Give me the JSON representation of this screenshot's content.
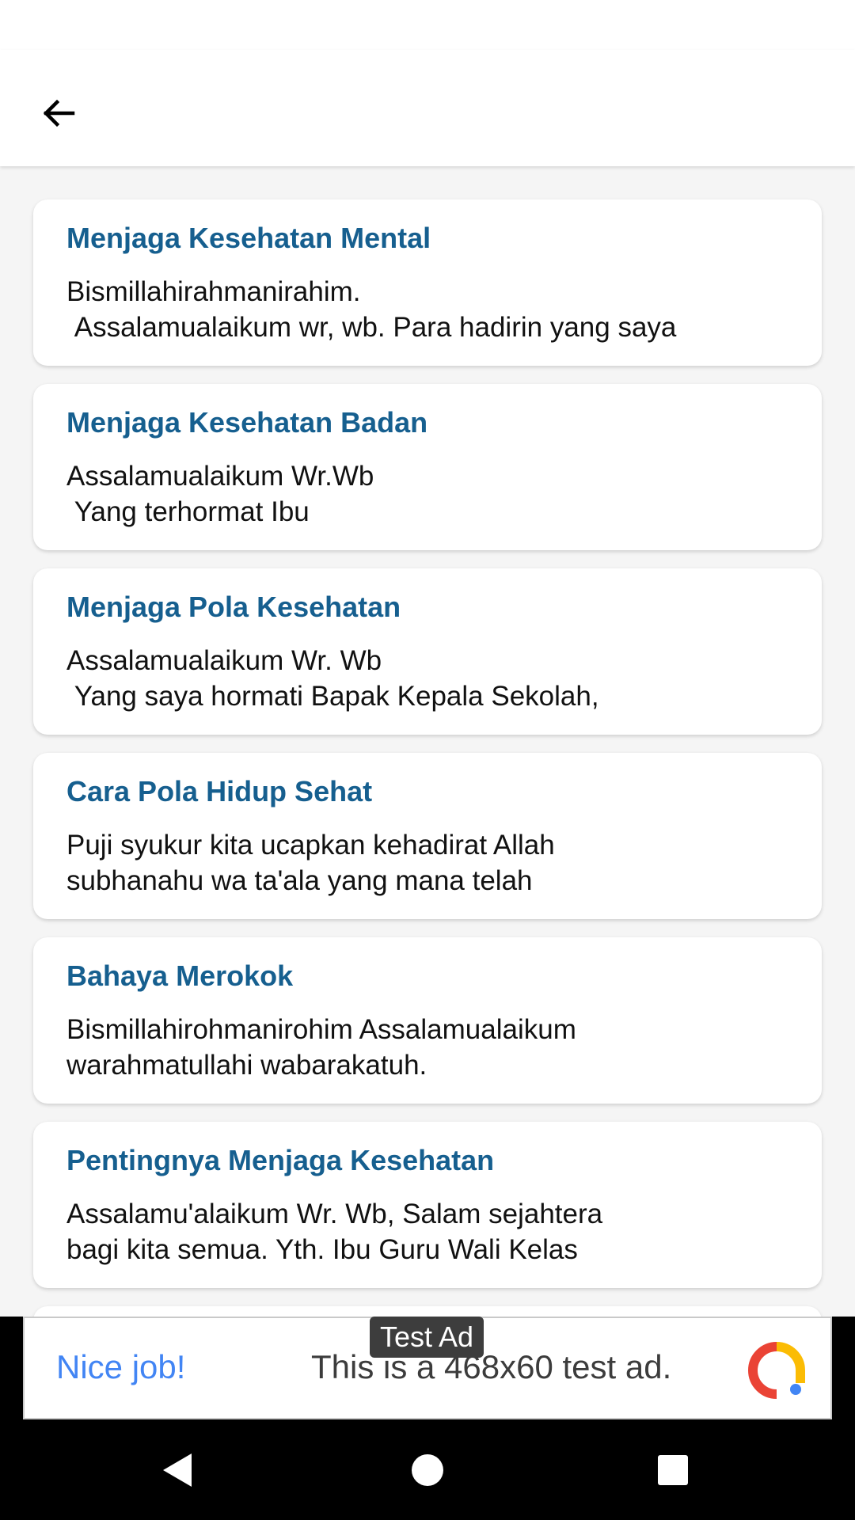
{
  "appbar": {
    "back_icon": "arrow-left-icon"
  },
  "cards": [
    {
      "title": "Menjaga Kesehatan Mental",
      "body": "Bismillahirahmanirahim.\n Assalamualaikum wr, wb. Para hadirin yang saya"
    },
    {
      "title": "Menjaga Kesehatan Badan",
      "body": "Assalamualaikum Wr.Wb\n Yang terhormat Ibu"
    },
    {
      "title": "Menjaga Pola Kesehatan",
      "body": "Assalamualaikum Wr. Wb\n Yang saya hormati Bapak Kepala Sekolah,"
    },
    {
      "title": "Cara Pola Hidup Sehat",
      "body": "Puji syukur kita ucapkan kehadirat Allah\nsubhanahu wa ta'ala yang mana telah"
    },
    {
      "title": "Bahaya Merokok",
      "body": "Bismillahirohmanirohim Assalamualaikum\nwarahmatullahi wabarakatuh."
    },
    {
      "title": "Pentingnya Menjaga Kesehatan",
      "body": "Assalamu'alaikum Wr. Wb, Salam sejahtera\nbagi kita semua. Yth. Ibu Guru Wali Kelas"
    }
  ],
  "ad": {
    "label": "Test Ad",
    "headline": "Nice job!",
    "text": "This is a 468x60 test ad.",
    "colors": {
      "headline": "#4285f4",
      "logo_red": "#ea4335",
      "logo_yellow": "#fbbc04",
      "logo_blue": "#4285f4"
    }
  },
  "navbar": {
    "back_icon": "nav-back-icon",
    "home_icon": "nav-home-icon",
    "recents_icon": "nav-recents-icon"
  },
  "colors": {
    "title": "#165f8f",
    "background": "#f5f5f5"
  }
}
